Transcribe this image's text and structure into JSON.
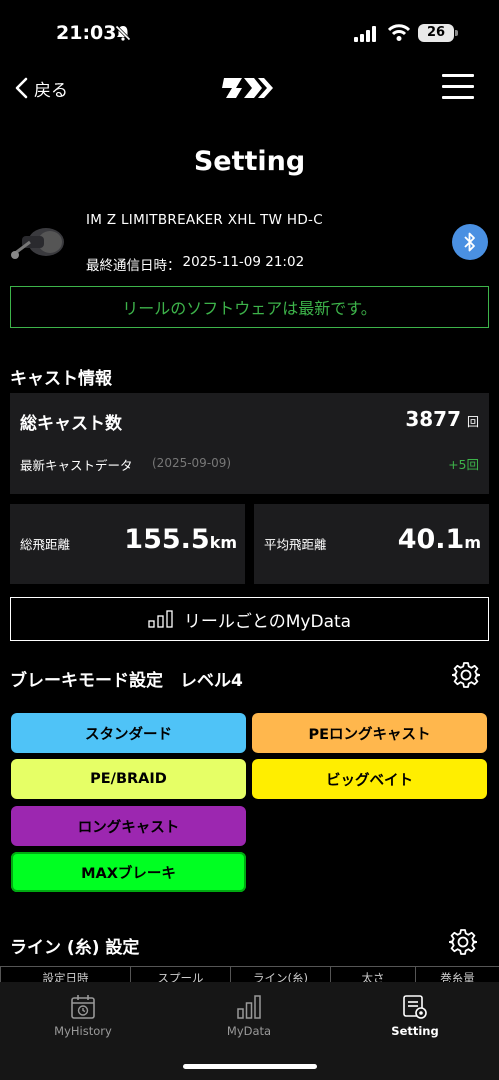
{
  "status_bar": {
    "time": "21:03",
    "battery": "26"
  },
  "header": {
    "back_label": "戻る",
    "title": "Setting"
  },
  "reel": {
    "name": "IM Z LIMITBREAKER XHL TW HD-C",
    "comm_label": "最終通信日時：",
    "comm_value": "2025-11-09 21:02",
    "software_status": "リールのソフトウェアは最新です。"
  },
  "cast_info": {
    "section_title": "キャスト情報",
    "total_label": "総キャスト数",
    "total_value": "3877",
    "total_unit": "回",
    "latest_label": "最新キャストデータ",
    "latest_date": "(2025-09-09)",
    "latest_value": "+5回",
    "total_distance_label": "総飛距離",
    "total_distance_value": "155.5",
    "total_distance_unit": "km",
    "avg_distance_label": "平均飛距離",
    "avg_distance_value": "40.1",
    "avg_distance_unit": "m",
    "mydata_button": "リールごとのMyData"
  },
  "brake": {
    "title": "ブレーキモード設定　レベル4",
    "modes": [
      {
        "label": "スタンダード",
        "color": "#4fc3f7"
      },
      {
        "label": "PEロングキャスト",
        "color": "#ffb74d"
      },
      {
        "label": "PE/BRAID",
        "color": "#e6ff66"
      },
      {
        "label": "ビッグベイト",
        "color": "#ffee00"
      },
      {
        "label": "ロングキャスト",
        "color": "#9c27b0"
      },
      {
        "label": "MAXブレーキ",
        "color": "#00ff22"
      }
    ]
  },
  "line": {
    "title": "ライン (糸) 設定",
    "columns": [
      "設定日時",
      "スプール",
      "ライン(糸)",
      "太さ",
      "巻糸量"
    ]
  },
  "tabs": [
    {
      "label": "MyHistory",
      "icon": "calendar-history-icon"
    },
    {
      "label": "MyData",
      "icon": "bar-chart-icon"
    },
    {
      "label": "Setting",
      "icon": "settings-list-icon"
    }
  ],
  "colors": {
    "accent_green": "#3db34a",
    "bluetooth": "#4a90e2"
  }
}
